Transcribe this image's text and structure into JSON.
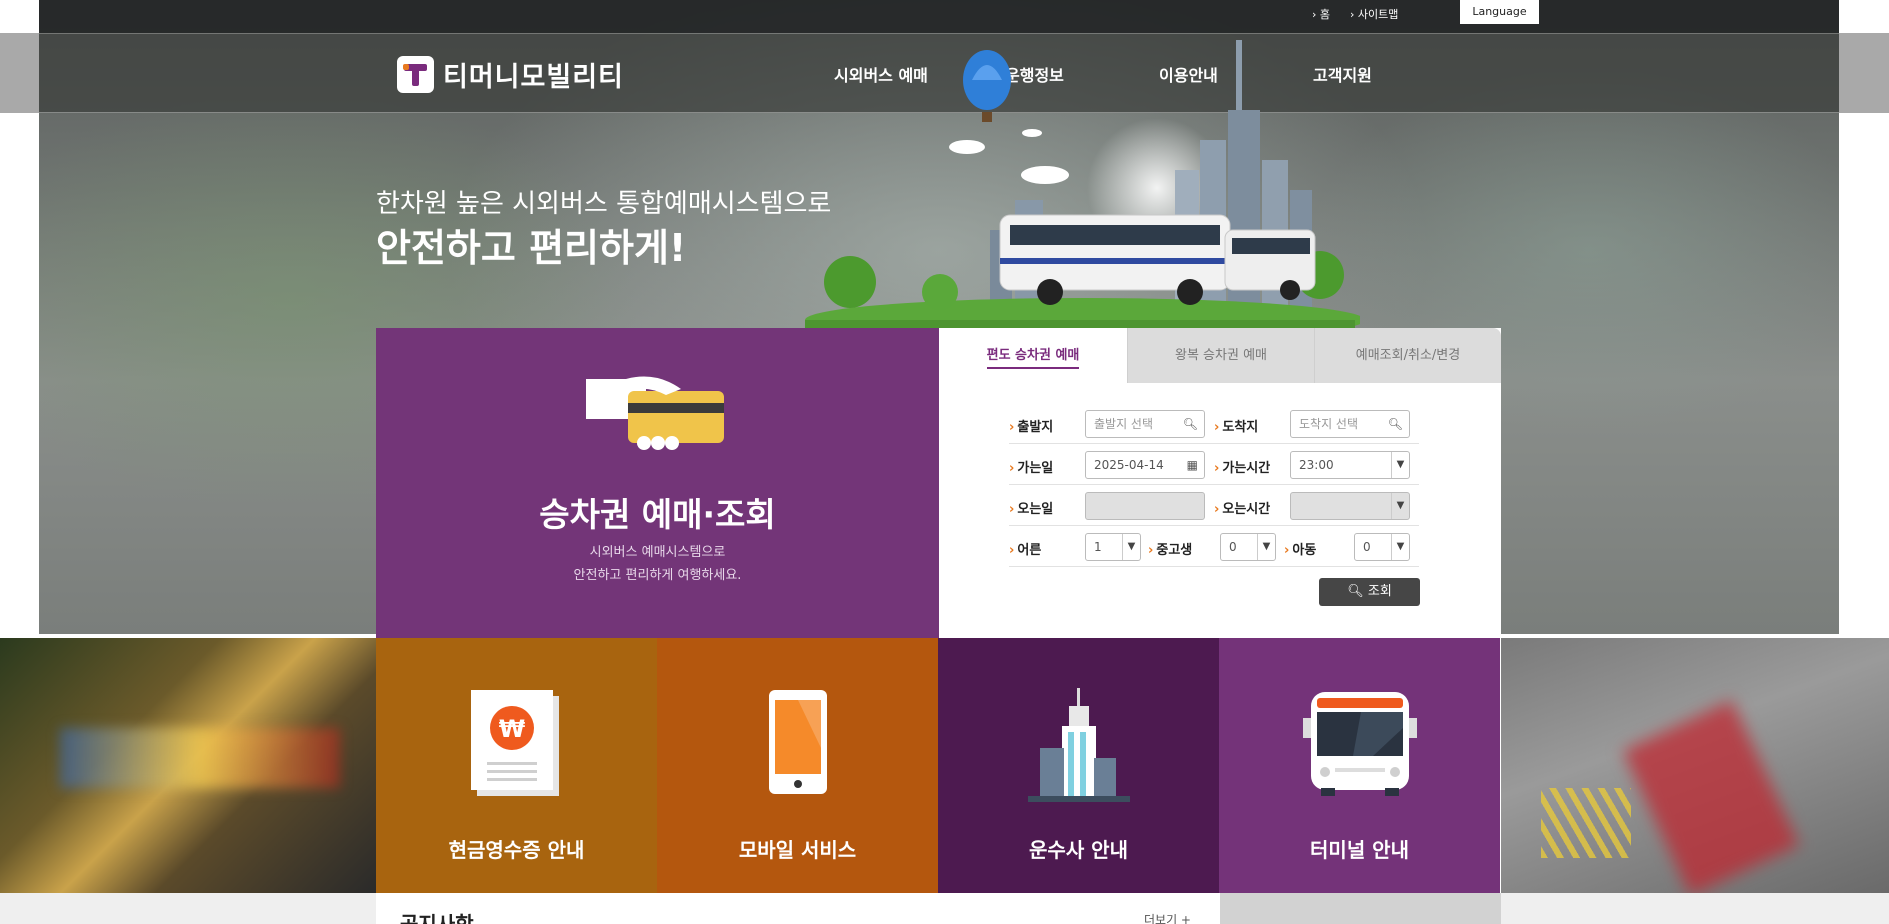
{
  "utility": {
    "home": "홈",
    "sitemap": "사이트맵",
    "language": "Language"
  },
  "brand": {
    "name": "티머니모빌리티"
  },
  "nav": [
    "시외버스 예매",
    "운행정보",
    "이용안내",
    "고객지원"
  ],
  "hero": {
    "subtitle": "한차원 높은 시외버스 통합예매시스템으로",
    "title": "안전하고 편리하게!"
  },
  "booking": {
    "title": "승차권 예매·조회",
    "desc_line1": "시외버스 예매시스템으로",
    "desc_line2": "안전하고 편리하게 여행하세요.",
    "tabs": [
      "편도 승차권 예매",
      "왕복 승차권 예매",
      "예매조회/취소/변경"
    ],
    "active_tab": "편도 승차권 예매",
    "form": {
      "departure_label": "출발지",
      "departure_placeholder": "출발지 선택",
      "arrival_label": "도착지",
      "arrival_placeholder": "도착지 선택",
      "go_date_label": "가는일",
      "go_date_value": "2025-04-14",
      "go_time_label": "가는시간",
      "go_time_value": "23:00",
      "return_date_label": "오는일",
      "return_time_label": "오는시간",
      "adult_label": "어른",
      "adult_value": "1",
      "youth_label": "중고생",
      "youth_value": "0",
      "child_label": "아동",
      "child_value": "0",
      "search_label": "조회"
    }
  },
  "services": [
    {
      "label": "현금영수증 안내",
      "color": "#a8640f"
    },
    {
      "label": "모바일 서비스",
      "color": "#b4570e"
    },
    {
      "label": "운수사 안내",
      "color": "#4d1a50"
    },
    {
      "label": "터미널 안내",
      "color": "#743379"
    }
  ],
  "notice": {
    "title": "공지사항",
    "more": "더보기 +"
  },
  "colors": {
    "brand_purple": "#733578",
    "accent_orange": "#e8791f",
    "dark_button": "#464646"
  }
}
